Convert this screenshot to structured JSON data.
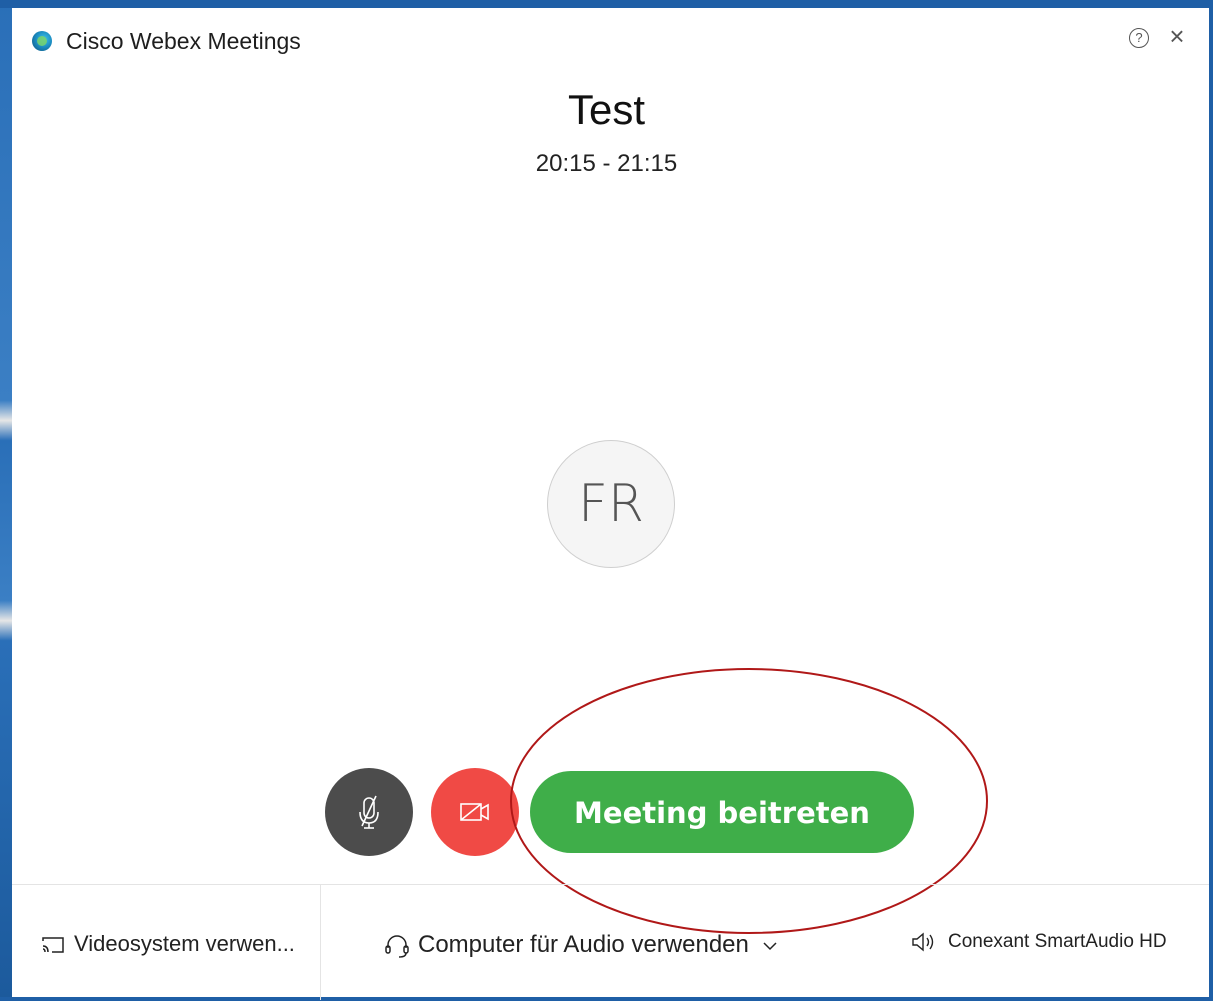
{
  "window": {
    "title": "Cisco Webex Meetings",
    "help_icon": "help-circle-icon",
    "close_icon": "close-icon"
  },
  "meeting": {
    "title": "Test",
    "time": "20:15 - 21:15"
  },
  "avatar": {
    "initials": "FR"
  },
  "controls": {
    "mute_icon": "microphone-muted-icon",
    "video_icon": "video-off-icon",
    "join_label": "Meeting beitreten"
  },
  "footer": {
    "video_system_label": "Videosystem verwen...",
    "audio_label": "Computer für Audio verwenden",
    "speaker_label": "Conexant SmartAudio HD"
  },
  "colors": {
    "join_green": "#3fae49",
    "video_red": "#f04a45",
    "mute_gray": "#4c4c4c",
    "annotation_red": "#b01818"
  }
}
